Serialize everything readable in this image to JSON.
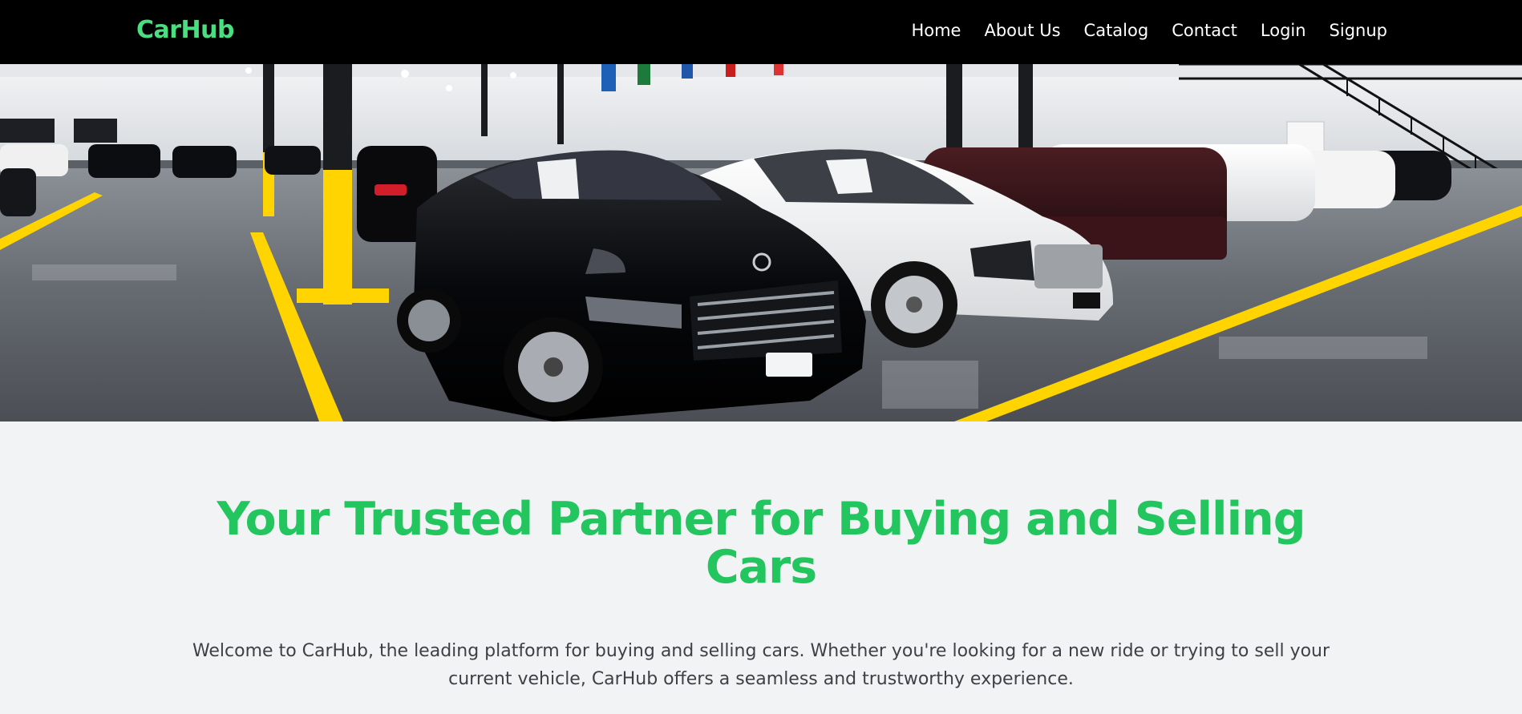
{
  "header": {
    "brand": "CarHub",
    "nav": [
      "Home",
      "About Us",
      "Catalog",
      "Contact",
      "Login",
      "Signup"
    ]
  },
  "hero": {
    "image_subject": "showroom-cars-photo"
  },
  "main": {
    "headline": "Your Trusted Partner for Buying and Selling Cars",
    "intro": "Welcome to CarHub, the leading platform for buying and selling cars. Whether you're looking for a new ride or trying to sell your current vehicle, CarHub offers a seamless and trustworthy experience."
  },
  "colors": {
    "brand_green": "#4ade80",
    "headline_green": "#22c55e",
    "nav_background": "#000000",
    "page_background": "#f2f3f5",
    "floor_stripe_yellow": "#ffd400"
  }
}
